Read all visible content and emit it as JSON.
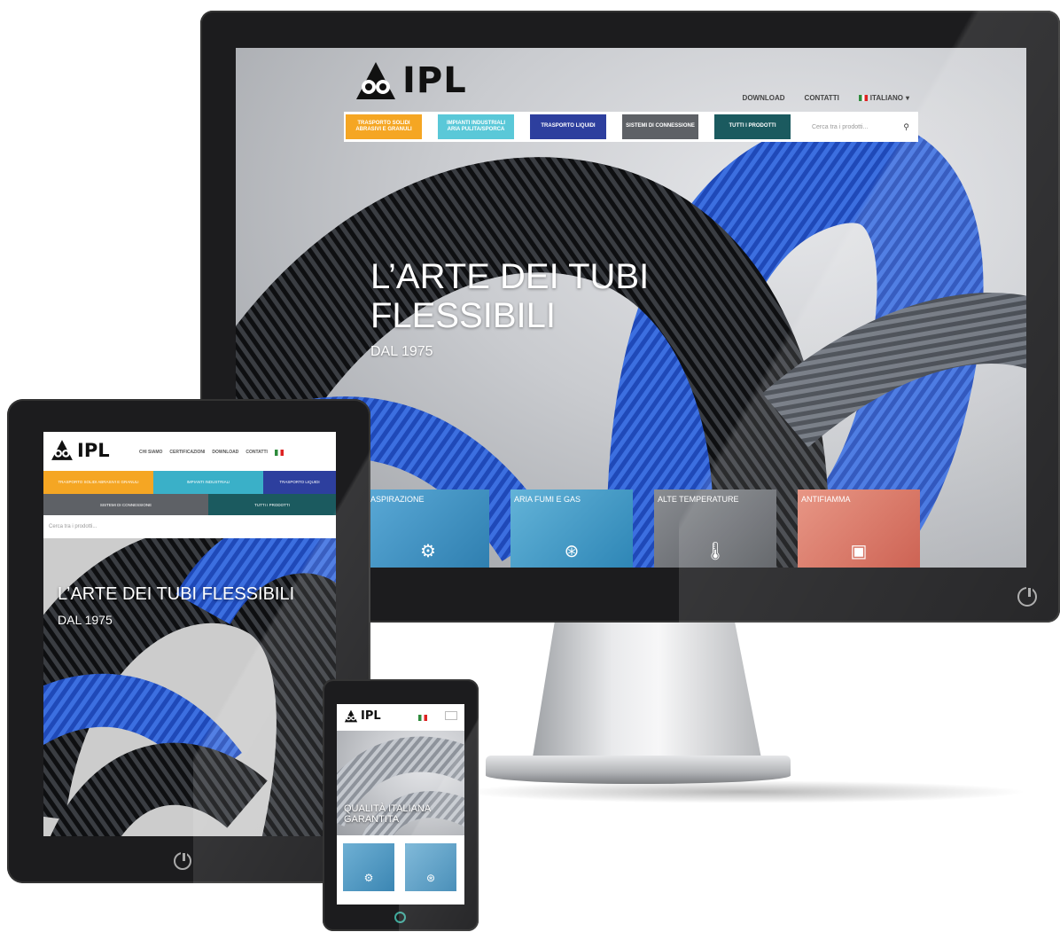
{
  "brand": {
    "name": "IPL"
  },
  "desktop": {
    "nav": [
      {
        "label": "DOWNLOAD"
      },
      {
        "label": "CONTATTI"
      }
    ],
    "language": "ITALIANO",
    "categories": [
      {
        "label": "TRASPORTO SOLIDI ABRASIVI E GRANULI",
        "color": "#f5a623"
      },
      {
        "label": "IMPIANTI INDUSTRIALI ARIA PULITA/SPORCA",
        "color": "#5ac8d8"
      },
      {
        "label": "TRASPORTO LIQUIDI",
        "color": "#2d3f9e"
      },
      {
        "label": "SISTEMI DI CONNESSIONE",
        "color": "#5e6166"
      },
      {
        "label": "TUTTI I PRODOTTI",
        "color": "#1b5a5f"
      }
    ],
    "search_placeholder": "Cerca tra i prodotti...",
    "hero_title": "L’ARTE DEI TUBI FLESSIBILI",
    "hero_subtitle": "DAL 1975",
    "tiles": [
      {
        "label": "ASPIRAZIONE",
        "icon": "fan-icon",
        "color": "#3b8fc0"
      },
      {
        "label": "ARIA FUMI E GAS",
        "icon": "ventilator-icon",
        "color": "#3a9ac4"
      },
      {
        "label": "ALTE TEMPERATURE",
        "icon": "thermometer-icon",
        "color": "#6a6d72"
      },
      {
        "label": "ANTIFIAMMA",
        "icon": "extinguisher-icon",
        "color": "#d86a58"
      }
    ]
  },
  "tablet": {
    "nav": [
      {
        "label": "CHI SIAMO"
      },
      {
        "label": "CERTIFICAZIONI"
      },
      {
        "label": "DOWNLOAD"
      },
      {
        "label": "CONTATTI"
      }
    ],
    "categories_row1": [
      {
        "label": "TRASPORTO SOLIDI ABRASIVI E GRANULI",
        "color": "#f5a623"
      },
      {
        "label": "IMPIANTI INDUSTRIALI",
        "color": "#3ab0c8"
      },
      {
        "label": "TRASPORTO LIQUIDI",
        "color": "#2d3f9e"
      }
    ],
    "categories_row2": [
      {
        "label": "SISTEMI DI CONNESSIONE",
        "color": "#5e6166"
      },
      {
        "label": "TUTTI I PRODOTTI",
        "color": "#1b5a5f"
      }
    ],
    "search_placeholder": "Cerca tra i prodotti...",
    "hero_title": "L’ARTE DEI TUBI FLESSIBILI",
    "hero_subtitle": "DAL 1975"
  },
  "phone": {
    "hero_title_line1": "QUALITÀ ITALIANA",
    "hero_title_line2": "GARANTITA",
    "tiles": [
      {
        "icon": "fan-icon"
      },
      {
        "icon": "ventilator-icon"
      }
    ]
  }
}
